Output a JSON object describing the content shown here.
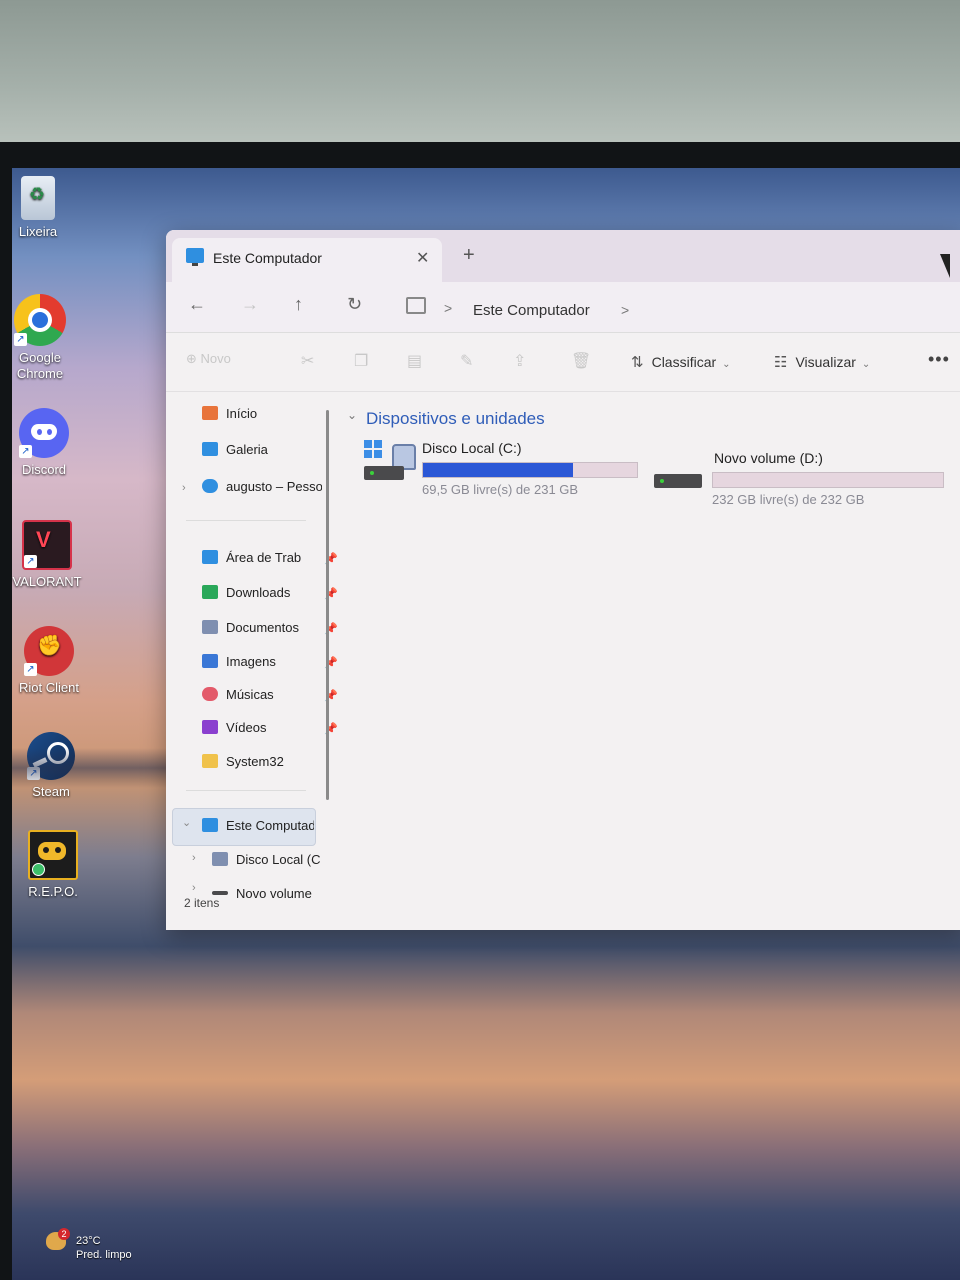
{
  "desktop": {
    "icons": [
      {
        "label": "Lixeira"
      },
      {
        "label": "Google Chrome"
      },
      {
        "label": "Discord"
      },
      {
        "label": "VALORANT"
      },
      {
        "label": "Riot Client"
      },
      {
        "label": "Steam"
      },
      {
        "label": "R.E.P.O."
      }
    ]
  },
  "explorer": {
    "tab_title": "Este Computador",
    "tab_close": "✕",
    "new_tab": "+",
    "address": {
      "back": "←",
      "forward": "→",
      "up": "↑",
      "refresh": "↻",
      "separator": ">",
      "path": "Este Computador",
      "trail": ">"
    },
    "toolbar": {
      "new_label": "Novo",
      "sort_icon": "⇅",
      "sort_label": "Classificar",
      "view_icon": "☷",
      "view_label": "Visualizar",
      "chevron": "⌄",
      "more": "•••"
    },
    "sidebar": {
      "top_items": [
        {
          "label": "Início",
          "color": "#e8743b"
        },
        {
          "label": "Galeria",
          "color": "#2f8fe0"
        },
        {
          "label": "augusto – Pesso",
          "color": "#2f8fe0"
        }
      ],
      "pinned_items": [
        {
          "label": "Área de Trab",
          "color": "#2f8fe0"
        },
        {
          "label": "Downloads",
          "color": "#2aa85a"
        },
        {
          "label": "Documentos",
          "color": "#7f8fb0"
        },
        {
          "label": "Imagens",
          "color": "#3a77d6"
        },
        {
          "label": "Músicas",
          "color": "#e35a6a"
        },
        {
          "label": "Vídeos",
          "color": "#8a3fcf"
        },
        {
          "label": "System32",
          "color": "#f0c24b"
        }
      ],
      "pin_icon": "📌",
      "expand_icon": "›",
      "collapse_icon": "⌄",
      "this_pc": "Este Computado",
      "drive_c": "Disco Local (C",
      "drive_d": "Novo volume"
    },
    "status": "2 itens",
    "section_chevron": "⌄",
    "section_title": "Dispositivos e unidades",
    "drives": [
      {
        "name": "Disco Local (C:)",
        "free": "69,5 GB livre(s) de 231 GB",
        "used_fraction": 0.7
      },
      {
        "name": "Novo volume (D:)",
        "free": "232 GB livre(s) de 232 GB",
        "used_fraction": 0.0
      }
    ]
  },
  "weather": {
    "badge": "2",
    "temp": "23°C",
    "condition": "Pred. limpo"
  }
}
